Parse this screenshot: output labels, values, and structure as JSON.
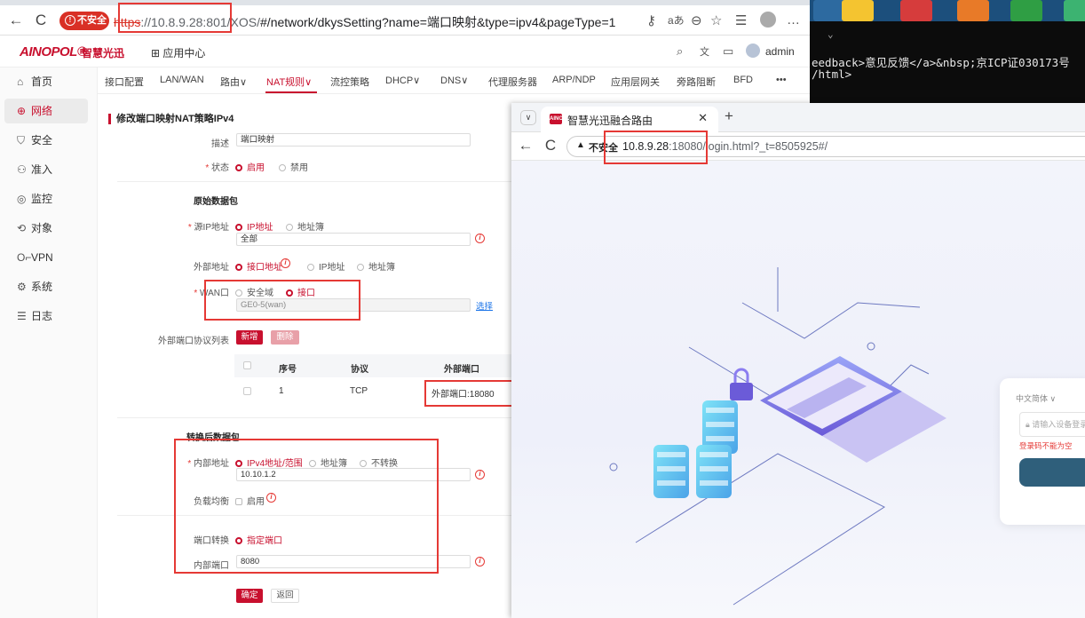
{
  "browser1": {
    "security_label": "不安全",
    "url_scheme": "https",
    "url_host": "://10.8.9.28",
    "url_port_path": ":801/XOS/",
    "url_rest": "#/network/dkysSetting?name=端口映射&type=ipv4&pageType=1",
    "accent_color": "#c8102e"
  },
  "terminal": {
    "chevron": "⌄",
    "line1": "eedback>意见反馈</a>&nbsp;京ICP证030173号",
    "line2": "/html>"
  },
  "app": {
    "logo": "AINOPOL®",
    "logo_sub": "智慧光迅",
    "app_center": "应用中心",
    "admin": "admin"
  },
  "sidebar": [
    {
      "icon": "home-icon",
      "glyph": "⌂",
      "label": "首页"
    },
    {
      "icon": "globe-icon",
      "glyph": "⊕",
      "label": "网络",
      "active": true
    },
    {
      "icon": "shield-icon",
      "glyph": "⛉",
      "label": "安全"
    },
    {
      "icon": "users-icon",
      "glyph": "⚇",
      "label": "准入"
    },
    {
      "icon": "monitor-icon",
      "glyph": "◎",
      "label": "监控"
    },
    {
      "icon": "object-icon",
      "glyph": "⟲",
      "label": "对象"
    },
    {
      "icon": "key-icon",
      "glyph": "O⌐",
      "label": "VPN"
    },
    {
      "icon": "settings-icon",
      "glyph": "⚙",
      "label": "系统"
    },
    {
      "icon": "list-icon",
      "glyph": "☰",
      "label": "日志"
    }
  ],
  "topnav": [
    "接口配置",
    "LAN/WAN",
    "路由∨",
    "NAT规则∨",
    "流控策略",
    "DHCP∨",
    "DNS∨",
    "代理服务器",
    "ARP/NDP",
    "应用层网关",
    "旁路阻断",
    "BFD",
    "•••"
  ],
  "form": {
    "title": "修改端口映射NAT策略IPv4",
    "desc_label": "描述",
    "desc_value": "端口映射",
    "status_label": "状态",
    "status_on": "启用",
    "status_off": "禁用",
    "orig_section": "原始数据包",
    "src_ip_label": "源IP地址",
    "src_opt1": "IP地址",
    "src_opt2": "地址簿",
    "src_value": "全部",
    "ext_addr_label": "外部地址",
    "ext_opt1": "接口地址",
    "ext_opt2": "IP地址",
    "ext_opt3": "地址簿",
    "wan_label": "WAN口",
    "wan_opt1": "安全域",
    "wan_opt2": "接口",
    "wan_value": "GE0-5(wan)",
    "select_link": "选择",
    "ext_port_list_label": "外部端口协议列表",
    "btn_add": "新增",
    "btn_delete": "删除",
    "table_headers": [
      "序号",
      "协议",
      "外部端口"
    ],
    "table_rows": [
      {
        "no": "1",
        "proto": "TCP",
        "port": "外部端口:18080"
      }
    ],
    "trans_section": "转换后数据包",
    "inner_addr_label": "内部地址",
    "inner_opt1": "IPv4地址/范围",
    "inner_opt2": "地址簿",
    "inner_opt3": "不转换",
    "inner_value": "10.10.1.2",
    "lb_label": "负载均衡",
    "lb_opt": "启用",
    "port_trans_label": "端口转换",
    "port_trans_opt": "指定端口",
    "inner_port_label": "内部端口",
    "inner_port_value": "8080",
    "btn_ok": "确定",
    "btn_back": "返回"
  },
  "browser2": {
    "tab_title": "智慧光迅融合路由",
    "favicon_text": "AINO",
    "not_safe": "不安全",
    "url_host": "10.8.9.28",
    "url_rest": ":18080/login.html?_t=8505925#/",
    "lang": "中文简体 ∨",
    "pwd_placeholder": "请输入设备登录",
    "pwd_error": "登录码不能为空"
  }
}
